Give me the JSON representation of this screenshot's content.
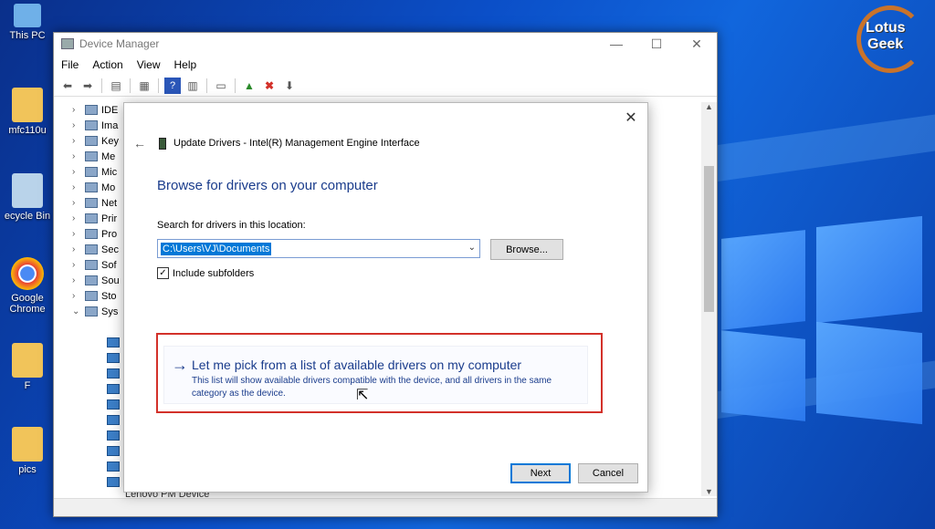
{
  "desktop": {
    "icons": [
      {
        "label": "This PC",
        "icon": "this-pc-icon"
      },
      {
        "label": "mfc110u",
        "icon": "folder-icon"
      },
      {
        "label": "ecycle Bin",
        "icon": "recycle-bin-icon"
      },
      {
        "label": "Google Chrome",
        "icon": "chrome-icon"
      },
      {
        "label": "F",
        "icon": "folder-icon"
      },
      {
        "label": "pics",
        "icon": "folder-icon"
      }
    ],
    "logo": {
      "line1": "Lotus",
      "line2": "Geek"
    }
  },
  "device_manager": {
    "title": "Device Manager",
    "controls": {
      "minimize": "—",
      "maximize": "☐",
      "close": "✕"
    },
    "menu": [
      "File",
      "Action",
      "View",
      "Help"
    ],
    "tree": [
      {
        "label": "IDE",
        "expanded": false
      },
      {
        "label": "Ima",
        "expanded": false
      },
      {
        "label": "Key",
        "expanded": false
      },
      {
        "label": "Me",
        "expanded": false
      },
      {
        "label": "Mic",
        "expanded": false
      },
      {
        "label": "Mo",
        "expanded": false
      },
      {
        "label": "Net",
        "expanded": false
      },
      {
        "label": "Prir",
        "expanded": false
      },
      {
        "label": "Pro",
        "expanded": false
      },
      {
        "label": "Sec",
        "expanded": false
      },
      {
        "label": "Sof",
        "expanded": false
      },
      {
        "label": "Sou",
        "expanded": false
      },
      {
        "label": "Sto",
        "expanded": false
      },
      {
        "label": "Sys",
        "expanded": true
      }
    ],
    "bottom_item": "Lenovo PM Device"
  },
  "dialog": {
    "close": "✕",
    "back": "←",
    "title": "Update Drivers - Intel(R) Management Engine Interface",
    "heading": "Browse for drivers on your computer",
    "search_label": "Search for drivers in this location:",
    "path_value": "C:\\Users\\VJ\\Documents",
    "browse_label": "Browse...",
    "include_subfolders": "Include subfolders",
    "include_subfolders_checked": true,
    "pick": {
      "arrow": "→",
      "title": "Let me pick from a list of available drivers on my computer",
      "description": "This list will show available drivers compatible with the device, and all drivers in the same category as the device."
    },
    "next_label": "Next",
    "cancel_label": "Cancel"
  },
  "colors": {
    "accent": "#0078d7",
    "link": "#1a3c8c",
    "highlight_border": "#d3312a"
  }
}
